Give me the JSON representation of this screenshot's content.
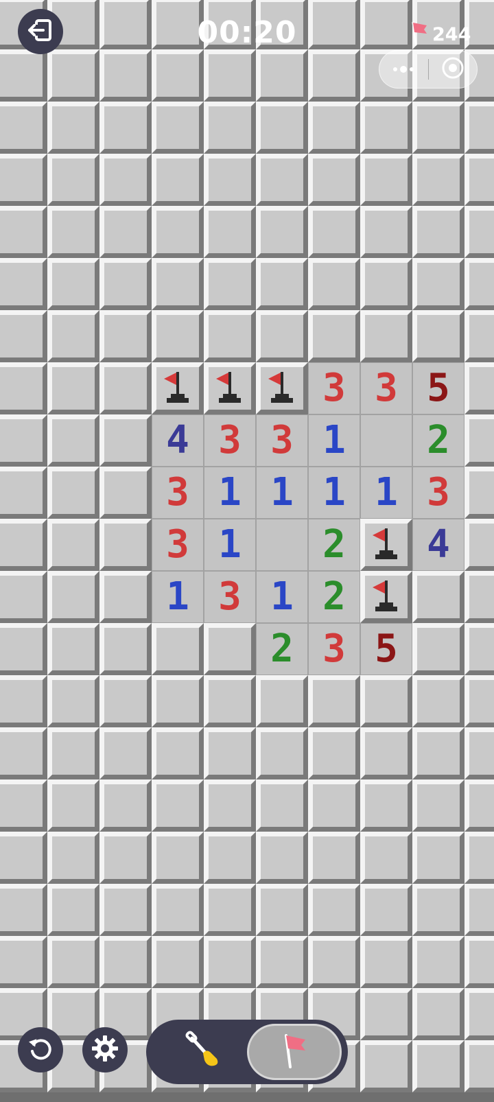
{
  "header": {
    "timer": "00:20",
    "flags_remaining": "244",
    "exit_icon": "exit-icon",
    "more_icon": "more-dots-icon",
    "close_icon": "target-icon"
  },
  "board": {
    "columns": 10,
    "rows": 21,
    "first_column": -1,
    "revealed": [
      {
        "r": 7,
        "c": 2,
        "v": "F"
      },
      {
        "r": 7,
        "c": 3,
        "v": "F"
      },
      {
        "r": 7,
        "c": 4,
        "v": "F"
      },
      {
        "r": 7,
        "c": 5,
        "v": "3"
      },
      {
        "r": 7,
        "c": 6,
        "v": "3"
      },
      {
        "r": 7,
        "c": 7,
        "v": "5"
      },
      {
        "r": 8,
        "c": 2,
        "v": "4"
      },
      {
        "r": 8,
        "c": 3,
        "v": "3"
      },
      {
        "r": 8,
        "c": 4,
        "v": "3"
      },
      {
        "r": 8,
        "c": 5,
        "v": "1"
      },
      {
        "r": 8,
        "c": 6,
        "v": ""
      },
      {
        "r": 8,
        "c": 7,
        "v": "2"
      },
      {
        "r": 9,
        "c": 2,
        "v": "3"
      },
      {
        "r": 9,
        "c": 3,
        "v": "1"
      },
      {
        "r": 9,
        "c": 4,
        "v": "1"
      },
      {
        "r": 9,
        "c": 5,
        "v": "1"
      },
      {
        "r": 9,
        "c": 6,
        "v": "1"
      },
      {
        "r": 9,
        "c": 7,
        "v": "3"
      },
      {
        "r": 10,
        "c": 2,
        "v": "3"
      },
      {
        "r": 10,
        "c": 3,
        "v": "1"
      },
      {
        "r": 10,
        "c": 4,
        "v": ""
      },
      {
        "r": 10,
        "c": 5,
        "v": "2"
      },
      {
        "r": 10,
        "c": 6,
        "v": "F"
      },
      {
        "r": 10,
        "c": 7,
        "v": "4"
      },
      {
        "r": 11,
        "c": 2,
        "v": "1"
      },
      {
        "r": 11,
        "c": 3,
        "v": "3"
      },
      {
        "r": 11,
        "c": 4,
        "v": "1"
      },
      {
        "r": 11,
        "c": 5,
        "v": "2"
      },
      {
        "r": 11,
        "c": 6,
        "v": "F"
      },
      {
        "r": 12,
        "c": 4,
        "v": "2"
      },
      {
        "r": 12,
        "c": 5,
        "v": "3"
      },
      {
        "r": 12,
        "c": 6,
        "v": "5"
      }
    ]
  },
  "controls": {
    "restart_icon": "restart-icon",
    "settings_icon": "gear-icon",
    "mode": "flag",
    "dig_icon": "shovel-icon",
    "flag_icon": "flag-icon"
  },
  "colors": {
    "n1": "#2a46c6",
    "n2": "#2b8d2b",
    "n3": "#d13a3a",
    "n4": "#3a3a96",
    "n5": "#8b1616",
    "button_bg": "#3c3c50"
  }
}
